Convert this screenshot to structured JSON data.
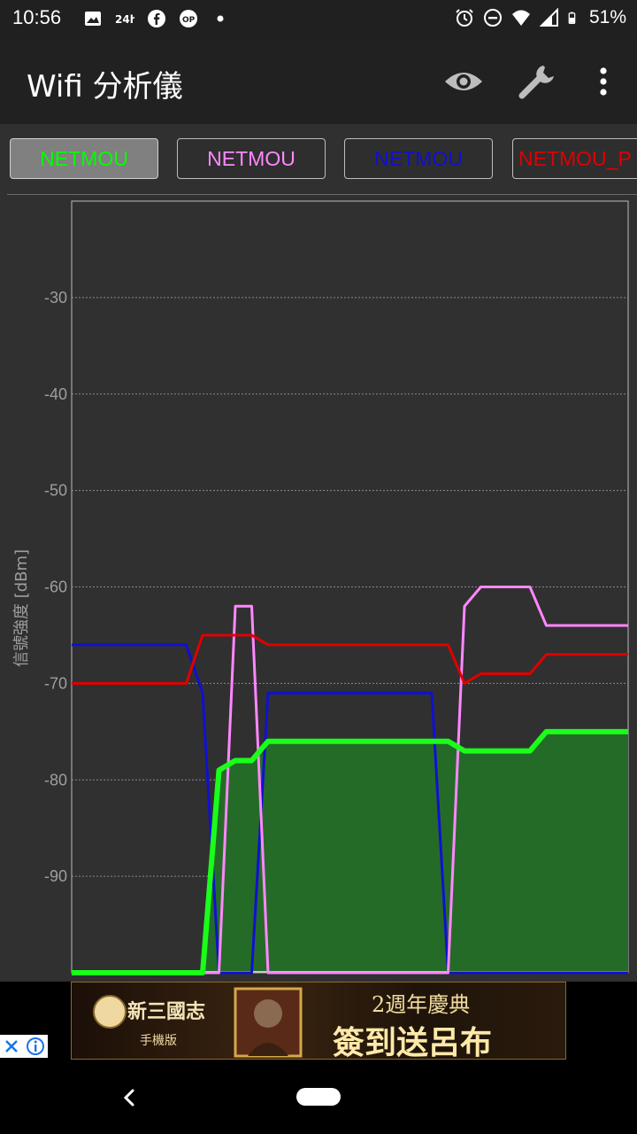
{
  "status_bar": {
    "time": "10:56",
    "battery": "51%",
    "left_icons": [
      "image-icon",
      "24h-icon",
      "facebook-icon",
      "op-icon",
      "dot-icon"
    ],
    "right_icons": [
      "alarm-icon",
      "dnd-icon",
      "wifi-icon",
      "signal-icon",
      "battery-icon"
    ]
  },
  "app_bar": {
    "title": "Wifi 分析儀",
    "actions": [
      "eye-icon",
      "wrench-icon",
      "more-vert-icon"
    ]
  },
  "tabs": [
    {
      "label": "NETMOU",
      "color": "#00ff00",
      "selected": true
    },
    {
      "label": "NETMOU",
      "color": "#ff88ff",
      "selected": false
    },
    {
      "label": "NETMOU",
      "color": "#1010d0",
      "selected": false
    },
    {
      "label": "NETMOU_P",
      "color": "#e00000",
      "selected": false
    }
  ],
  "chart_data": {
    "type": "line",
    "ylabel": "信號強度 [dBm]",
    "ylim": [
      -100,
      -20
    ],
    "yticks": [
      -30,
      -40,
      -50,
      -60,
      -70,
      -80,
      -90
    ],
    "grid": true,
    "x": [
      0,
      1,
      2,
      3,
      4,
      5,
      6,
      7,
      8,
      9,
      10,
      11,
      12,
      13,
      14,
      15,
      16,
      17,
      18,
      19,
      20,
      21,
      22,
      23,
      24,
      25,
      26,
      27,
      28,
      29,
      30,
      31,
      32,
      33,
      34
    ],
    "series": [
      {
        "name": "NETMOU",
        "color": "#1aff1a",
        "fill": "#256b28",
        "values": [
          -100,
          -100,
          -100,
          -100,
          -100,
          -100,
          -100,
          -100,
          -100,
          -79,
          -78,
          -78,
          -76,
          -76,
          -76,
          -76,
          -76,
          -76,
          -76,
          -76,
          -76,
          -76,
          -76,
          -76,
          -77,
          -77,
          -77,
          -77,
          -77,
          -75,
          -75,
          -75,
          -75,
          -75,
          -75
        ]
      },
      {
        "name": "NETMOU",
        "color": "#ff88ff",
        "values": [
          -100,
          -100,
          -100,
          -100,
          -100,
          -100,
          -100,
          -100,
          -100,
          -100,
          -62,
          -62,
          -100,
          -100,
          -100,
          -100,
          -100,
          -100,
          -100,
          -100,
          -100,
          -100,
          -100,
          -100,
          -62,
          -60,
          -60,
          -60,
          -60,
          -64,
          -64,
          -64,
          -64,
          -64,
          -64
        ]
      },
      {
        "name": "NETMOU",
        "color": "#1010d0",
        "values": [
          -66,
          -66,
          -66,
          -66,
          -66,
          -66,
          -66,
          -66,
          -71,
          -100,
          -100,
          -100,
          -71,
          -71,
          -71,
          -71,
          -71,
          -71,
          -71,
          -71,
          -71,
          -71,
          -71,
          -100,
          -100,
          -100,
          -100,
          -100,
          -100,
          -100,
          -100,
          -100,
          -100,
          -100,
          -100
        ]
      },
      {
        "name": "NETMOU_P",
        "color": "#e00000",
        "values": [
          -70,
          -70,
          -70,
          -70,
          -70,
          -70,
          -70,
          -70,
          -65,
          -65,
          -65,
          -65,
          -66,
          -66,
          -66,
          -66,
          -66,
          -66,
          -66,
          -66,
          -66,
          -66,
          -66,
          -66,
          -70,
          -69,
          -69,
          -69,
          -69,
          -67,
          -67,
          -67,
          -67,
          -67,
          -67
        ]
      }
    ]
  },
  "ad": {
    "banner_text_top": "2週年慶典",
    "banner_text_bottom": "簽到送呂布",
    "brand": "新三國志",
    "brand_sub": "手機版"
  }
}
